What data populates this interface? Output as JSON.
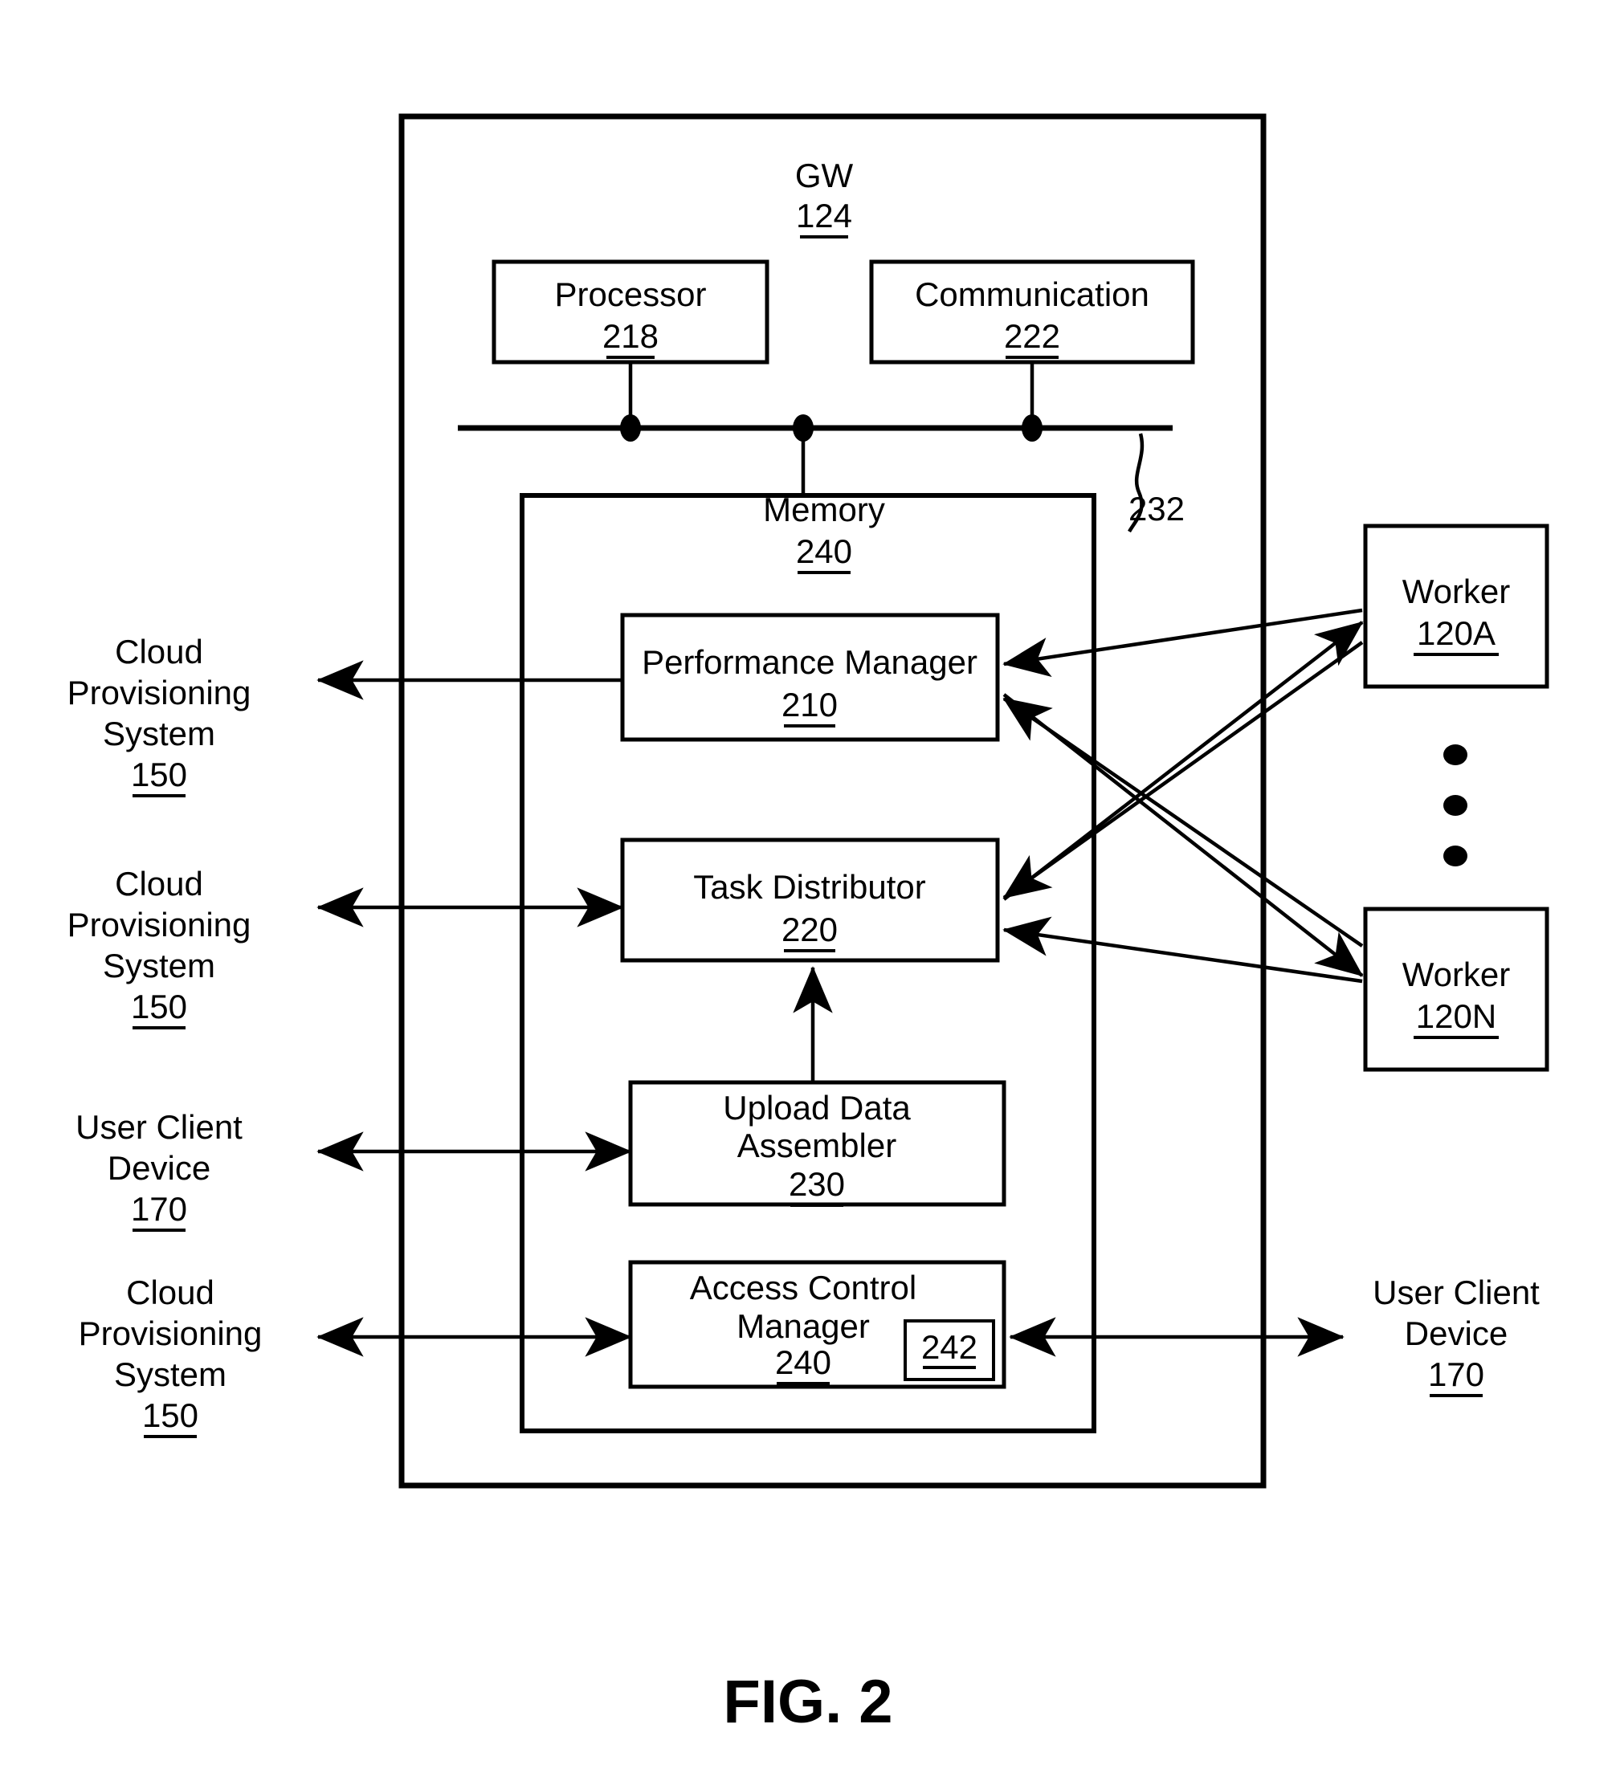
{
  "figure": {
    "caption": "FIG. 2"
  },
  "gateway": {
    "title": "GW",
    "ref": "124",
    "components": {
      "processor": {
        "label": "Processor",
        "ref": "218"
      },
      "communication": {
        "label": "Communication",
        "ref": "222"
      },
      "bus": {
        "ref": "232"
      }
    },
    "memory": {
      "label": "Memory",
      "ref": "240",
      "modules": [
        {
          "label": "Performance Manager",
          "ref": "210"
        },
        {
          "label": "Task Distributor",
          "ref": "220"
        },
        {
          "label_line1": "Upload Data",
          "label_line2": "Assembler",
          "ref": "230"
        },
        {
          "label_line1": "Access Control",
          "label_line2": "Manager",
          "ref": "240",
          "inner_ref": "242"
        }
      ]
    }
  },
  "external_left": [
    {
      "line1": "Cloud",
      "line2": "Provisioning",
      "line3": "System",
      "ref": "150"
    },
    {
      "line1": "Cloud",
      "line2": "Provisioning",
      "line3": "System",
      "ref": "150"
    },
    {
      "line1": "User Client",
      "line2": "Device",
      "ref": "170"
    },
    {
      "line1": "Cloud",
      "line2": "Provisioning",
      "line3": "System",
      "ref": "150"
    }
  ],
  "external_right": {
    "workers": [
      {
        "label": "Worker",
        "ref": "120A"
      },
      {
        "label": "Worker",
        "ref": "120N"
      }
    ],
    "ellipsis": "•",
    "user_client": {
      "line1": "User Client",
      "line2": "Device",
      "ref": "170"
    }
  },
  "colors": {
    "stroke": "#000000",
    "background": "#ffffff"
  }
}
